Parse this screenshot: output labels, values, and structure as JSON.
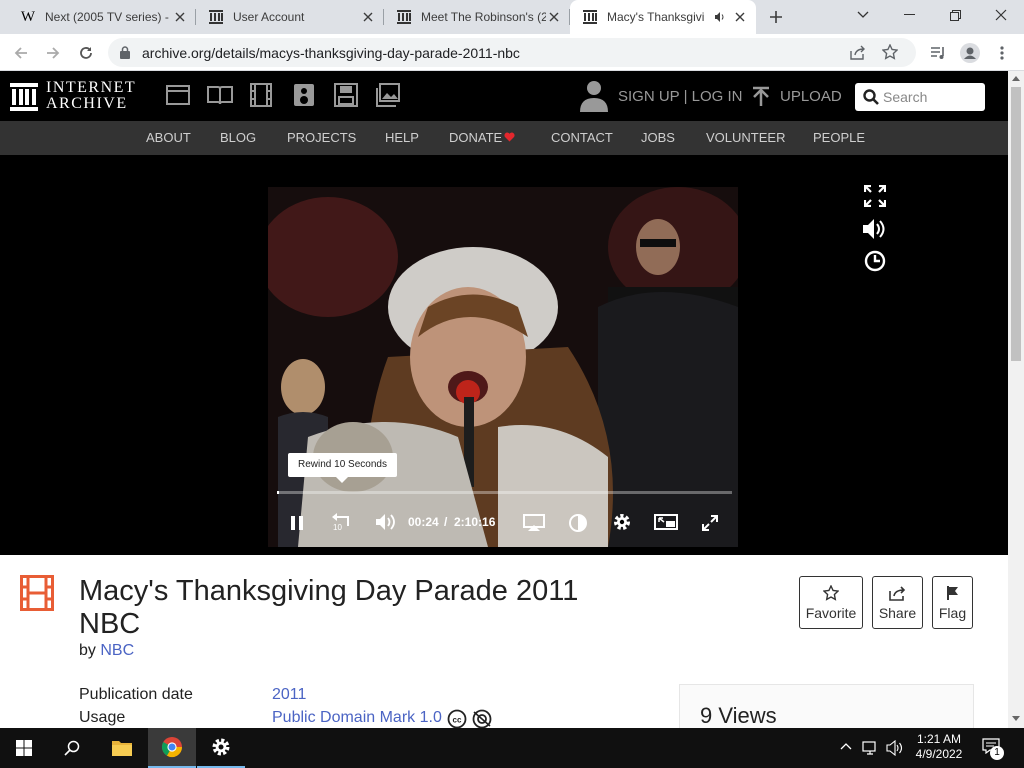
{
  "browser": {
    "tabs": [
      {
        "title": "Next (2005 TV series) -",
        "favicon": "wikipedia-icon"
      },
      {
        "title": "User Account",
        "favicon": "internet-archive-icon"
      },
      {
        "title": "Meet The Robinson's (2",
        "favicon": "internet-archive-icon"
      },
      {
        "title": "Macy's Thanksgivi",
        "favicon": "internet-archive-icon",
        "active": true,
        "audio": true
      }
    ],
    "url": "archive.org/details/macys-thanksgiving-day-parade-2011-nbc"
  },
  "site": {
    "logo_line1": "INTERNET",
    "logo_line2": "ARCHIVE",
    "signin": "SIGN UP | LOG IN",
    "upload": "UPLOAD",
    "search_placeholder": "Search",
    "nav": [
      "ABOUT",
      "BLOG",
      "PROJECTS",
      "HELP",
      "DONATE",
      "CONTACT",
      "JOBS",
      "VOLUNTEER",
      "PEOPLE"
    ]
  },
  "player": {
    "tooltip": "Rewind 10 Seconds",
    "current_time": "00:24",
    "separator": "/",
    "duration": "2:10:16",
    "progress_fraction": 0.003,
    "rewind_seconds": "10"
  },
  "item": {
    "title_line1": "Macy's Thanksgiving Day Parade 2011",
    "title_line2": "NBC",
    "by_label": "by",
    "by_value": "NBC",
    "publication_label": "Publication date",
    "publication_value": "2011",
    "usage_label": "Usage",
    "usage_value": "Public Domain Mark 1.0",
    "views": "9 Views",
    "actions": {
      "favorite": "Favorite",
      "share": "Share",
      "flag": "Flag"
    }
  },
  "taskbar": {
    "time": "1:21 AM",
    "date": "4/9/2022",
    "notification_count": "1"
  },
  "colors": {
    "accent_link": "#4b64c4",
    "donate_heart": "#e3272d",
    "ia_header": "#000000",
    "ia_nav": "#333333"
  }
}
